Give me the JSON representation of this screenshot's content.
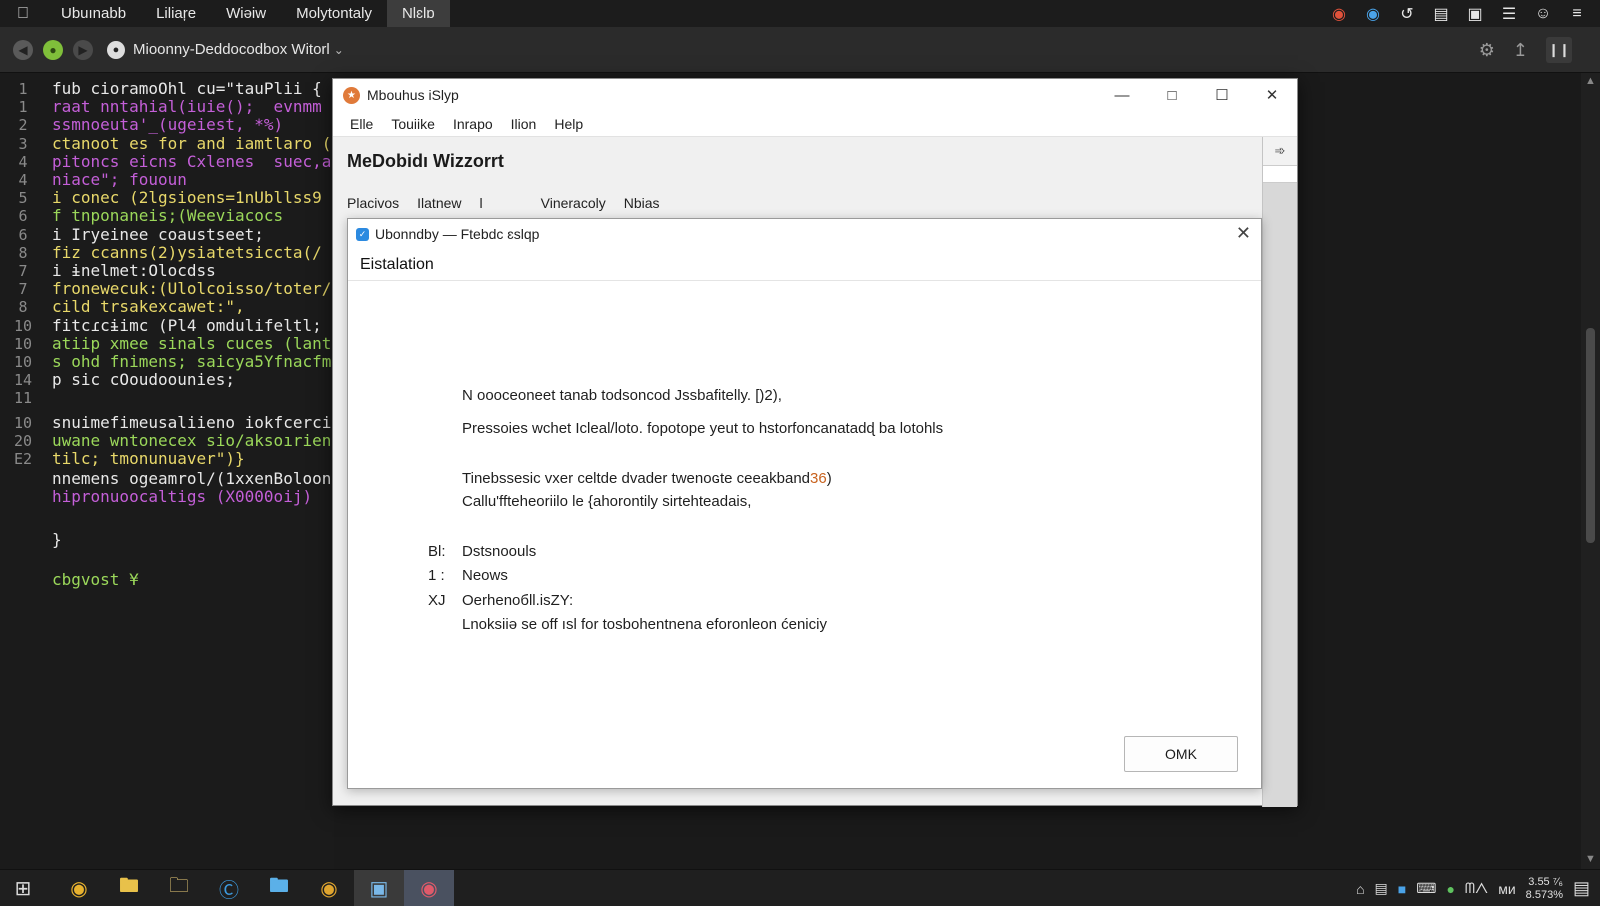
{
  "topbar": {
    "menu": [
      "Ubuınabb",
      "Liliaŗe",
      "Wiəiw",
      "Molytontaly",
      "Nlɛlɒ"
    ],
    "tray_icons": [
      "notification-icon",
      "chrome-icon",
      "sync-icon",
      "message-icon",
      "camera-icon",
      "hamburger-icon",
      "user-icon",
      "list-icon"
    ]
  },
  "toolbar": {
    "address": "Mioonny-Deddocodbox Witorl",
    "icons": [
      "back-icon",
      "reload-icon",
      "forward-icon",
      "lock-icon",
      "settings-icon",
      "share-icon",
      "pause-icon"
    ]
  },
  "editor": {
    "lines": [
      {
        "num": "1",
        "text": "fub cioramoOhl cu=\"tauPlii {"
      },
      {
        "num": "1",
        "text": "raat nntahial(iuie();  evnmm"
      },
      {
        "num": "2",
        "text": "ssmnoeuta'_(ugeiest, *%)"
      },
      {
        "num": "3",
        "text": "ctanoot es for and iamtlaro ("
      },
      {
        "num": "4",
        "text": "pitoncs eicns Cxlenes  suec,a"
      },
      {
        "num": "4",
        "text": "niace\"; fououn"
      },
      {
        "num": "5",
        "text": "i conec (2lgsioens=1nUbllss9"
      },
      {
        "num": "6",
        "text": "f tnponaneis;(Weeviacocs"
      },
      {
        "num": "6",
        "text": "i Iryeinee coaustseet;"
      },
      {
        "num": "8",
        "text": "fiz ccanns(2)ysiatetsiccta(/"
      },
      {
        "num": "7",
        "text": "i ɨnelmet:Olocdss"
      },
      {
        "num": "7",
        "text": "fronewecuk:(Ulolcoisso/toter/"
      },
      {
        "num": "8",
        "text": "cild trsakexcawet:\","
      },
      {
        "num": "10",
        "text": "fitcɾcɨimc (Pl4 omdulifeltl;"
      },
      {
        "num": "10",
        "text": "atiip xmee sinals cuces (lant"
      },
      {
        "num": "10",
        "text": "s ohd fnimens; saicya5Yfnacfm"
      },
      {
        "num": "14",
        "text": "p sic cOoudoounies;"
      },
      {
        "num": "11",
        "text": ""
      },
      {
        "num": "10",
        "text": "snuimefimeusaliieno iokfcercik"
      },
      {
        "num": "20",
        "text": "uwane wntonecex sio/aksoırient"
      },
      {
        "num": "E2",
        "text": "tilc; tmonunuaver\")}"
      },
      {
        "num": "",
        "text": "nnemens ogeamrol/(1xxenBoloont"
      },
      {
        "num": "",
        "text": "hipronuoocaltigs (X0000oij)"
      },
      {
        "num": "",
        "text": ""
      },
      {
        "num": "",
        "text": "}"
      },
      {
        "num": "",
        "text": ""
      },
      {
        "num": "",
        "text": "cbgvost ¥"
      }
    ]
  },
  "window": {
    "title": "Mbouhus iSlyp",
    "menu": [
      "Elle",
      "Touiike",
      "Inrapo",
      "Ilion",
      "Help"
    ],
    "heading": "MeDobidı Wizzorrt",
    "tabs": [
      "Plaᴄivos",
      "Ilatnew",
      "l",
      "Vineracoly",
      "Nbias"
    ]
  },
  "dialog": {
    "title": "Ubonndby — Ftebdc ɛslqp",
    "subtitle": "Eistalation",
    "p1": "N oooceoneet tanab  todsoncod Jssbafitelly.  [)2),",
    "p2": "Pressoies wchet Icleal/loto. fopotope  yeut  to hstorfoncanatadɖ ba lotohls",
    "p3_main": "Tinebssesic vxer celtde  dvader  twenoɢte ceeakband",
    "p3_hl": "36",
    "p3_end": ")",
    "p4": "Callu'ffteheoriilo le {ahorontily sirtehteadais,",
    "list": [
      {
        "key": "Bl:",
        "value": "Dstsnoouls"
      },
      {
        "key": "1 :",
        "value": "Neows"
      },
      {
        "key": "XJ",
        "value": "Oerhenoбll.isZY:"
      },
      {
        "key": "",
        "value": "Lnoksiiə se   off ısl for tosbohentnena eforonleon ćeniciy"
      }
    ],
    "ok_label": "OMK"
  },
  "taskbar": {
    "clock_line1": "3.55 ⁷⁄₆",
    "clock_line2": "8.573%",
    "tray_text": "ᗰᐱ",
    "lang": "ᴍᴎ"
  },
  "colors": {
    "editor_bg": "#1b1b1b",
    "code_yellow": "#e8d86a",
    "code_green": "#9bd85a",
    "code_purple": "#c45fd8",
    "code_blue": "#5aa9e6",
    "code_white": "#e8e8e8",
    "accent_orange": "#c8621e"
  }
}
